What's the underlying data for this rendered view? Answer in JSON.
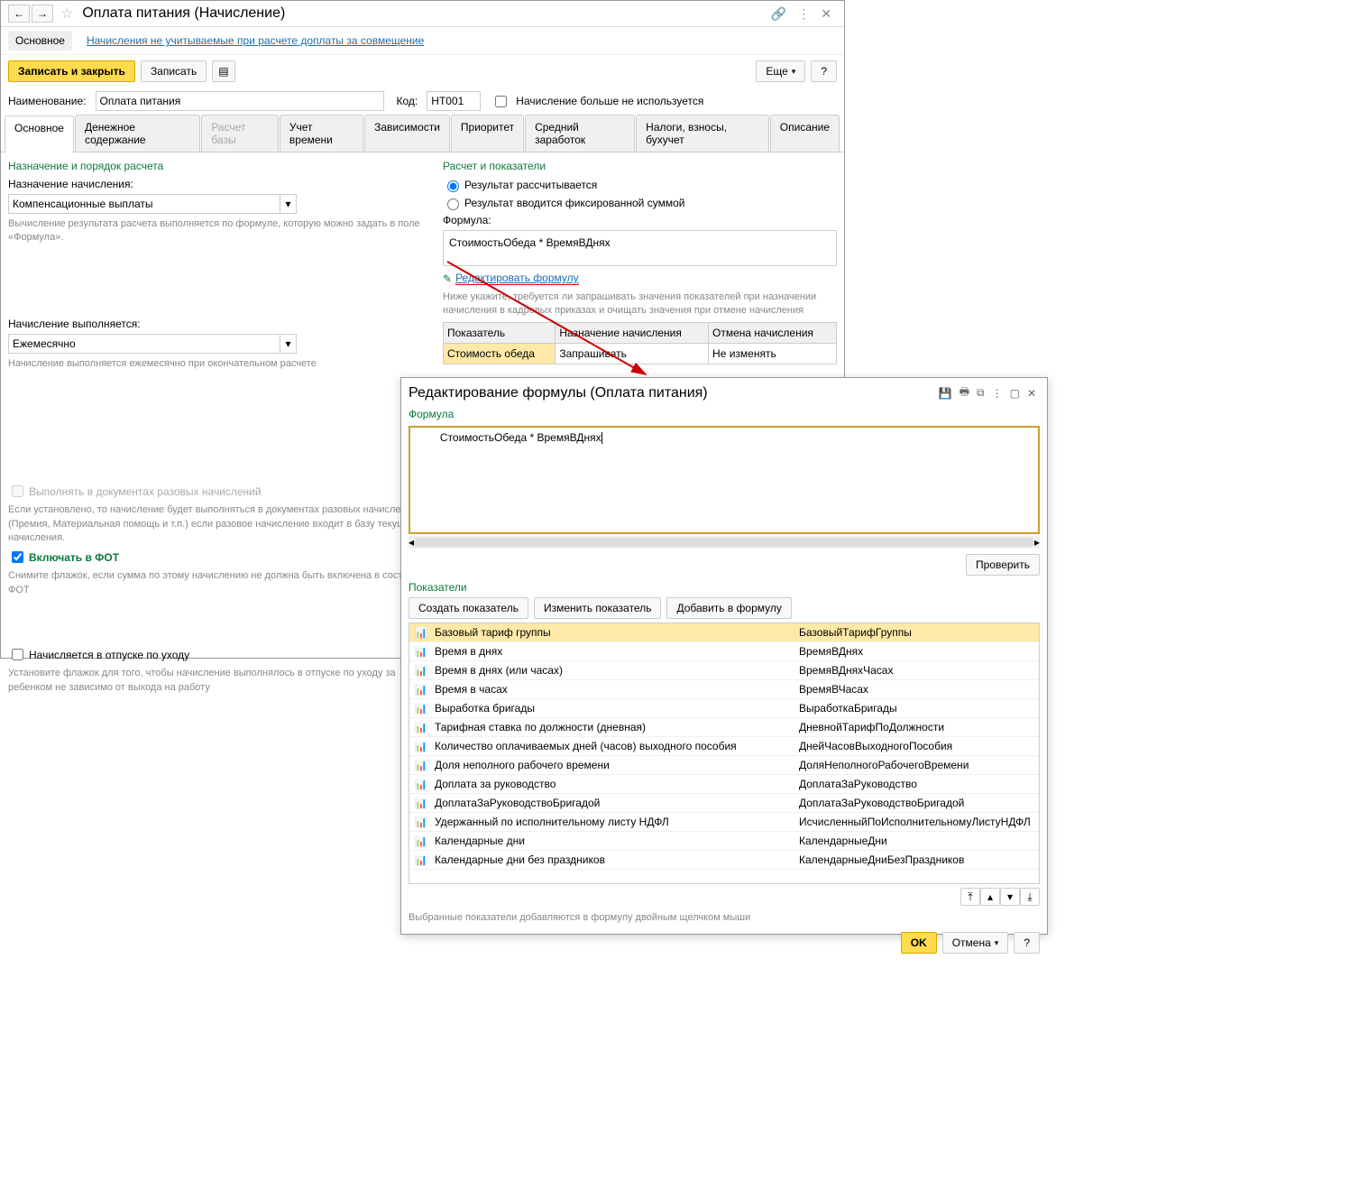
{
  "win1": {
    "title": "Оплата питания (Начисление)",
    "subtabs": [
      "Основное",
      "Начисления не учитываемые при расчете доплаты за совмещение"
    ],
    "toolbar": {
      "save_close": "Записать и закрыть",
      "save": "Записать",
      "more": "Еще",
      "help": "?"
    },
    "name_label": "Наименование:",
    "name_value": "Оплата питания",
    "code_label": "Код:",
    "code_value": "HT001",
    "unused_label": "Начисление больше не используется",
    "tabs": [
      "Основное",
      "Денежное содержание",
      "Расчет базы",
      "Учет времени",
      "Зависимости",
      "Приоритет",
      "Средний заработок",
      "Налоги, взносы, бухучет",
      "Описание"
    ],
    "left": {
      "section1_title": "Назначение и порядок расчета",
      "purpose_label": "Назначение начисления:",
      "purpose_value": "Компенсационные выплаты",
      "purpose_help": "Вычисление результата расчета выполняется по формуле, которую можно задать в поле «Формула».",
      "exec_label": "Начисление выполняется:",
      "exec_value": "Ежемесячно",
      "exec_help": "Начисление выполняется ежемесячно при окончательном расчете",
      "cb1_label": "Выполнять в документах разовых начислений",
      "cb1_help": "Если установлено, то начисление будет выполняться в документах разовых начислений (Премия, Материальная помощь и т.п.) если разовое начисление входит в базу текущего начисления.",
      "cb2_label": "Включать в ФОТ",
      "cb2_help": "Снимите флажок, если сумма по этому начислению не должна быть включена в состав ФОТ",
      "cb3_label": "Начисляется в отпуске по уходу",
      "cb3_help": "Установите флажок для того, чтобы начисление выполнялось в отпуске по уходу за ребенком не зависимо от выхода на работу"
    },
    "right": {
      "section2_title": "Расчет и показатели",
      "radio1": "Результат рассчитывается",
      "radio2": "Результат вводится фиксированной суммой",
      "formula_label": "Формула:",
      "formula_value": "СтоимостьОбеда *  ВремяВДнях",
      "edit_link": "Редактировать формулу",
      "ind_help": "Ниже укажите, требуется ли запрашивать значения показателей при назначении начисления в кадровых приказах и очищать значения при отмене начисления",
      "ind_headers": [
        "Показатель",
        "Назначение начисления",
        "Отмена начисления"
      ],
      "ind_row": [
        "Стоимость обеда",
        "Запрашивать",
        "Не изменять"
      ]
    }
  },
  "win2": {
    "title": "Редактирование формулы (Оплата питания)",
    "formula_label": "Формула",
    "formula_text": "СтоимостьОбеда  *   ВремяВДнях",
    "check_btn": "Проверить",
    "indicators_label": "Показатели",
    "btn_create": "Создать показатель",
    "btn_edit": "Изменить показатель",
    "btn_add": "Добавить в формулу",
    "list": [
      {
        "name": "Базовый тариф группы",
        "code": "БазовыйТарифГруппы"
      },
      {
        "name": "Время в днях",
        "code": "ВремяВДнях"
      },
      {
        "name": "Время в днях (или часах)",
        "code": "ВремяВДняхЧасах"
      },
      {
        "name": "Время в часах",
        "code": "ВремяВЧасах"
      },
      {
        "name": "Выработка бригады",
        "code": "ВыработкаБригады"
      },
      {
        "name": "Тарифная ставка по должности (дневная)",
        "code": "ДневнойТарифПоДолжности"
      },
      {
        "name": "Количество оплачиваемых дней (часов) выходного пособия",
        "code": "ДнейЧасовВыходногоПособия"
      },
      {
        "name": "Доля неполного рабочего времени",
        "code": "ДоляНеполногоРабочегоВремени"
      },
      {
        "name": "Доплата за руководство",
        "code": "ДоплатаЗаРуководство"
      },
      {
        "name": "ДоплатаЗаРуководствоБригадой",
        "code": "ДоплатаЗаРуководствоБригадой"
      },
      {
        "name": "Удержанный по исполнительному листу НДФЛ",
        "code": "ИсчисленныйПоИсполнительномуЛистуНДФЛ"
      },
      {
        "name": "Календарные дни",
        "code": "КалендарныеДни"
      },
      {
        "name": "Календарные дни без праздников",
        "code": "КалендарныеДниБезПраздников"
      }
    ],
    "footer_note": "Выбранные показатели добавляются в формулу двойным щелчком мыши",
    "ok": "OK",
    "cancel": "Отмена",
    "help": "?"
  }
}
